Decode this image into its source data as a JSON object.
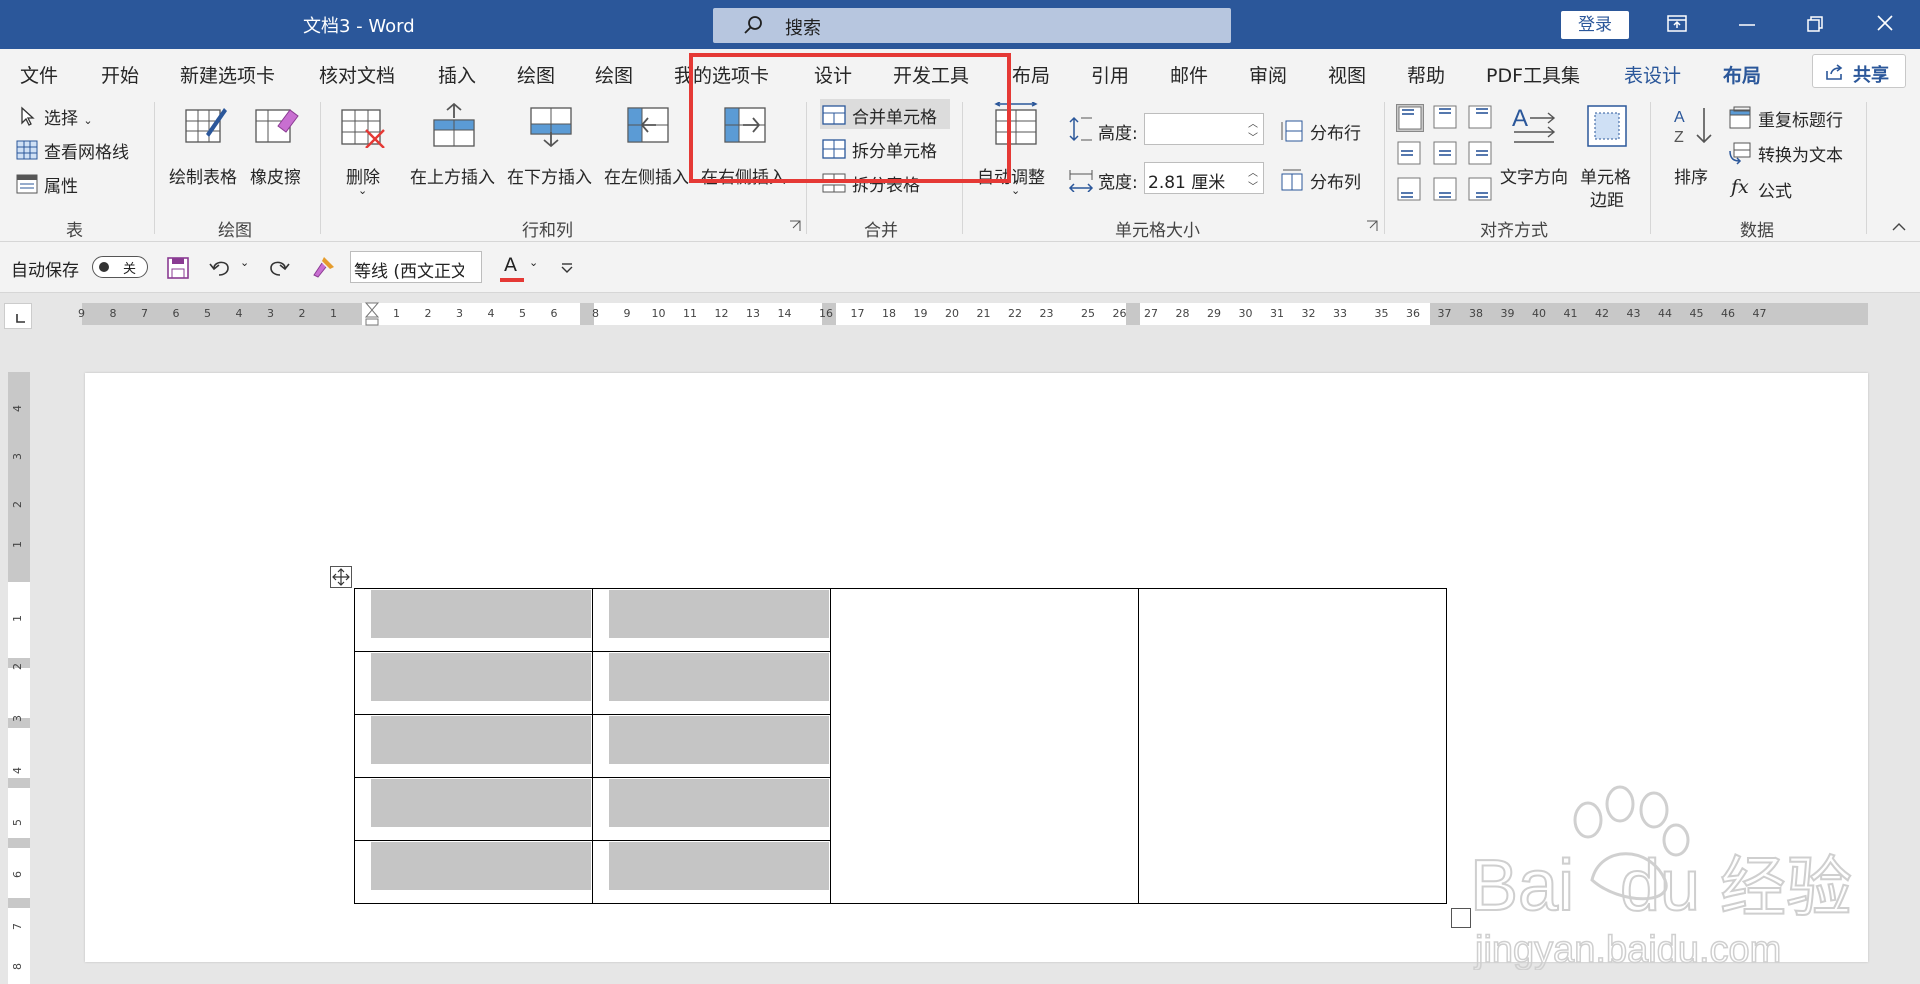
{
  "window": {
    "title": "文档3  -  Word",
    "search_placeholder": "搜索",
    "login_label": "登录"
  },
  "tabs": [
    {
      "label": "文件"
    },
    {
      "label": "开始"
    },
    {
      "label": "新建选项卡"
    },
    {
      "label": "核对文档"
    },
    {
      "label": "插入"
    },
    {
      "label": "绘图"
    },
    {
      "label": "绘图"
    },
    {
      "label": "我的选项卡"
    },
    {
      "label": "设计"
    },
    {
      "label": "开发工具"
    },
    {
      "label": "布局"
    },
    {
      "label": "引用"
    },
    {
      "label": "邮件"
    },
    {
      "label": "审阅"
    },
    {
      "label": "视图"
    },
    {
      "label": "帮助"
    },
    {
      "label": "PDF工具集"
    },
    {
      "label": "表设计"
    },
    {
      "label": "布局"
    }
  ],
  "share_label": "共享",
  "ribbon": {
    "table_group": {
      "label": "表",
      "select": "选择",
      "gridlines": "查看网格线",
      "properties": "属性"
    },
    "draw_group": {
      "label": "绘图",
      "draw_table": "绘制表格",
      "eraser": "橡皮擦"
    },
    "rows_cols_group": {
      "label": "行和列",
      "delete": "删除",
      "insert_above": "在上方插入",
      "insert_below": "在下方插入",
      "insert_left": "在左侧插入",
      "insert_right": "在右侧插入"
    },
    "merge_group": {
      "label": "合并",
      "merge_cells": "合并单元格",
      "split_cells": "拆分单元格",
      "split_table": "拆分表格"
    },
    "cell_size_group": {
      "label": "单元格大小",
      "autofit": "自动调整",
      "height_label": "高度:",
      "height_value": "",
      "width_label": "宽度:",
      "width_value": "2.81 厘米",
      "distribute_rows": "分布行",
      "distribute_cols": "分布列"
    },
    "align_group": {
      "label": "对齐方式",
      "text_direction": "文字方向",
      "cell_margins_1": "单元格",
      "cell_margins_2": "边距"
    },
    "data_group": {
      "label": "数据",
      "sort": "排序",
      "repeat_header": "重复标题行",
      "convert_text": "转换为文本",
      "formula": "公式"
    }
  },
  "qat": {
    "autosave_label": "自动保存",
    "toggle_state": "关",
    "font_name": "等线 (西文正文"
  },
  "ruler": {
    "h_numbers": [
      "9",
      "8",
      "7",
      "6",
      "5",
      "4",
      "3",
      "2",
      "1",
      "1",
      "2",
      "3",
      "4",
      "5",
      "6",
      "8",
      "9",
      "10",
      "11",
      "12",
      "13",
      "14",
      "16",
      "17",
      "18",
      "19",
      "20",
      "21",
      "22",
      "23",
      "25",
      "26",
      "27",
      "28",
      "29",
      "30",
      "31",
      "32",
      "33",
      "35",
      "36",
      "37",
      "38",
      "39",
      "40",
      "41",
      "42",
      "43",
      "44",
      "45",
      "46",
      "47"
    ],
    "v_numbers": [
      "4",
      "3",
      "2",
      "1",
      "1",
      "2",
      "3",
      "4",
      "5",
      "6",
      "7",
      "8"
    ]
  },
  "watermark": {
    "brand": "Bai",
    "brand2": "du",
    "cn": "经验",
    "url": "jingyan.baidu.com"
  },
  "colors": {
    "accent": "#2b579a",
    "highlight_box": "#e53935",
    "shaded_cell": "#c5c5c5"
  }
}
